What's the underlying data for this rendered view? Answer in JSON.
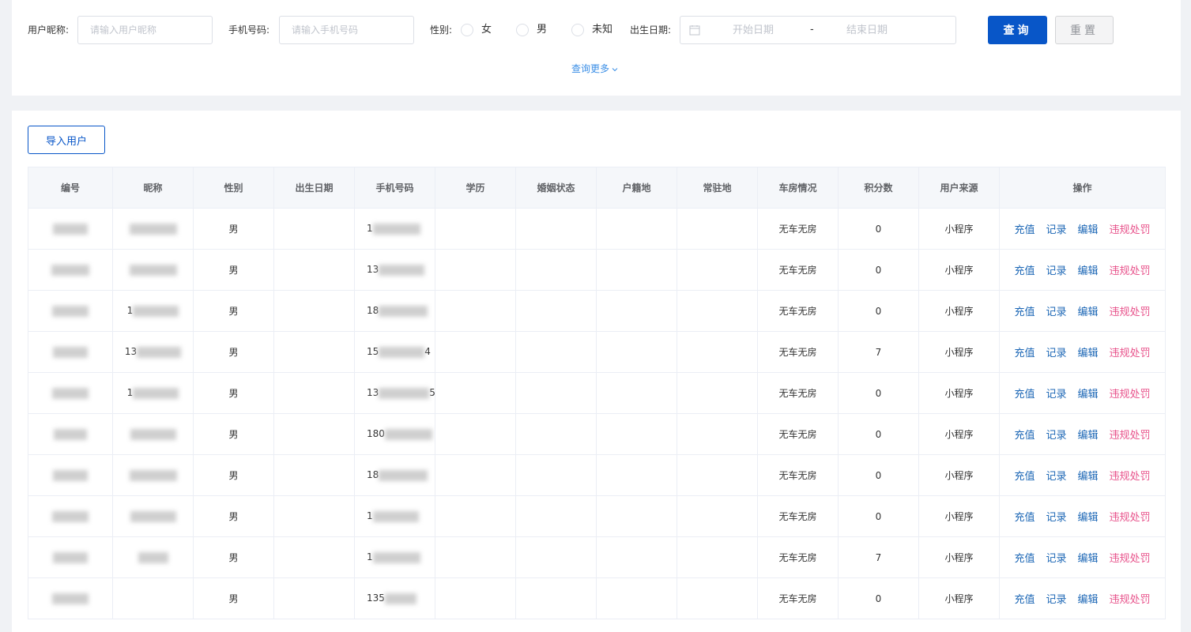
{
  "search": {
    "nickname_label": "用户昵称:",
    "nickname_placeholder": "请输入用户昵称",
    "phone_label": "手机号码:",
    "phone_placeholder": "请输入手机号码",
    "gender_label": "性别:",
    "gender_options": [
      "女",
      "男",
      "未知"
    ],
    "birth_label": "出生日期:",
    "start_placeholder": "开始日期",
    "date_separator": "-",
    "end_placeholder": "结束日期",
    "query_button": "查询",
    "reset_button": "重置",
    "more_link": "查询更多"
  },
  "toolbar": {
    "import_button": "导入用户"
  },
  "table": {
    "columns": [
      "编号",
      "昵称",
      "性别",
      "出生日期",
      "手机号码",
      "学历",
      "婚姻状态",
      "户籍地",
      "常驻地",
      "车房情况",
      "积分数",
      "用户来源",
      "操作"
    ],
    "actions": [
      "充值",
      "记录",
      "编辑",
      "违规处罚"
    ],
    "rows": [
      {
        "nick_prefix": "",
        "gender": "男",
        "phone_prefix": "1",
        "phone_suffix": "",
        "car_house": "无车无房",
        "points": "0",
        "source": "小程序"
      },
      {
        "nick_prefix": "",
        "gender": "男",
        "phone_prefix": "13",
        "phone_suffix": "",
        "car_house": "无车无房",
        "points": "0",
        "source": "小程序"
      },
      {
        "nick_prefix": "1",
        "gender": "男",
        "phone_prefix": "18",
        "phone_suffix": "",
        "car_house": "无车无房",
        "points": "0",
        "source": "小程序"
      },
      {
        "nick_prefix": "13",
        "gender": "男",
        "phone_prefix": "15",
        "phone_suffix": "4",
        "car_house": "无车无房",
        "points": "7",
        "source": "小程序"
      },
      {
        "nick_prefix": "1",
        "gender": "男",
        "phone_prefix": "13",
        "phone_suffix": "5",
        "car_house": "无车无房",
        "points": "0",
        "source": "小程序"
      },
      {
        "nick_prefix": "",
        "gender": "男",
        "phone_prefix": "180",
        "phone_suffix": "",
        "car_house": "无车无房",
        "points": "0",
        "source": "小程序"
      },
      {
        "nick_prefix": "",
        "gender": "男",
        "phone_prefix": "18",
        "phone_suffix": "",
        "car_house": "无车无房",
        "points": "0",
        "source": "小程序"
      },
      {
        "nick_prefix": "",
        "gender": "男",
        "phone_prefix": "1",
        "phone_suffix": "",
        "car_house": "无车无房",
        "points": "0",
        "source": "小程序"
      },
      {
        "nick_prefix": "",
        "gender": "男",
        "phone_prefix": "1",
        "phone_suffix": "",
        "car_house": "无车无房",
        "points": "7",
        "source": "小程序"
      },
      {
        "nick_prefix": "",
        "gender": "男",
        "phone_prefix": "135",
        "phone_suffix": "",
        "car_house": "无车无房",
        "points": "0",
        "source": "小程序"
      }
    ]
  },
  "colors": {
    "primary": "#0856c8",
    "link": "#1b66b5",
    "danger_link": "#e8528b",
    "more_link": "#3a8ee6"
  },
  "icons": {
    "calendar": "calendar-icon",
    "more": "chevron-down-icon"
  }
}
